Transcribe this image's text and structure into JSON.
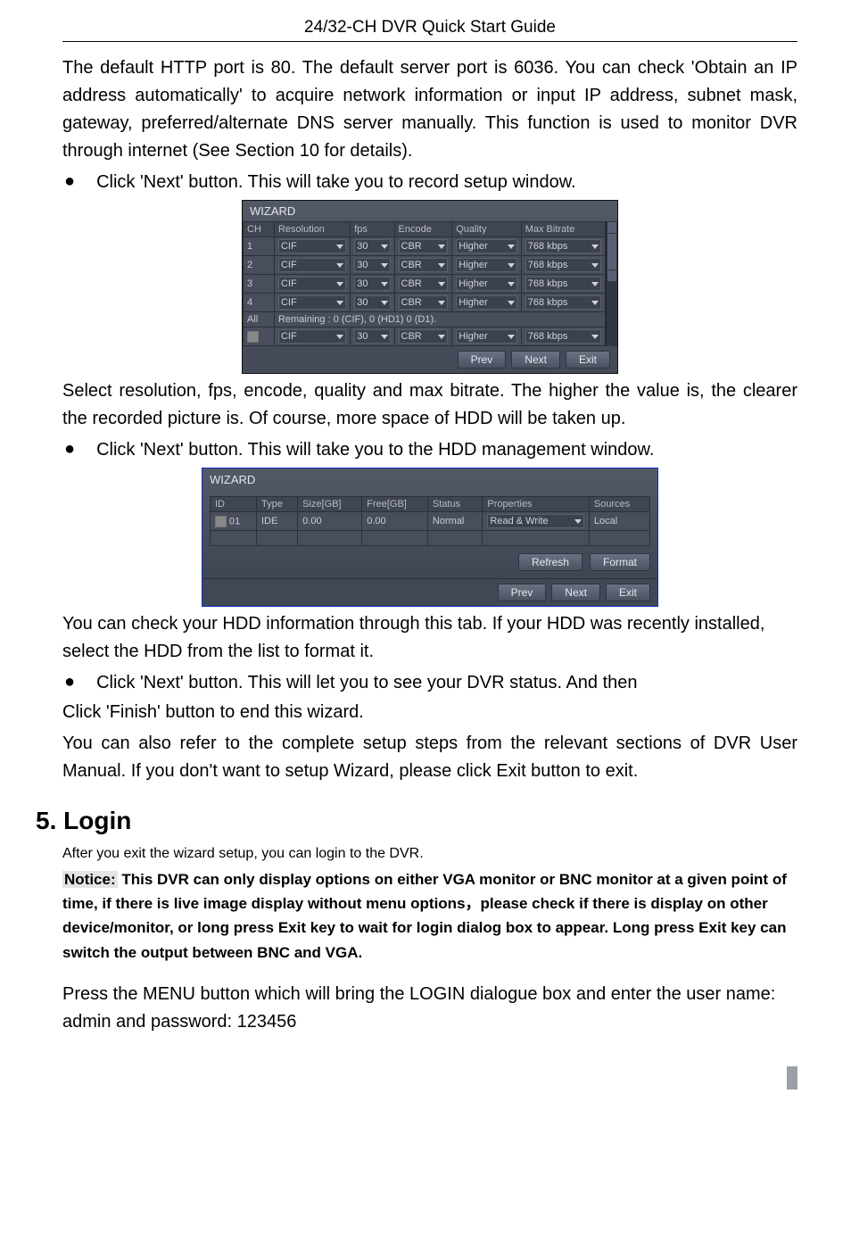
{
  "header": {
    "title": "24/32-CH DVR Quick Start Guide"
  },
  "p1": "The default HTTP port is 80. The default server port is 6036. You can check 'Obtain an IP address automatically' to acquire network information or input IP address, subnet mask, gateway, preferred/alternate DNS server manually. This function is used to monitor DVR through internet (See Section 10 for details).",
  "b1": "Click 'Next' button. This will take you to record setup window.",
  "wizardRec": {
    "title": "WIZARD",
    "cols": {
      "ch": "CH",
      "res": "Resolution",
      "fps": "fps",
      "enc": "Encode",
      "qual": "Quality",
      "br": "Max Bitrate"
    },
    "rows": [
      {
        "ch": "1",
        "res": "CIF",
        "fps": "30",
        "enc": "CBR",
        "qual": "Higher",
        "br": "768 kbps"
      },
      {
        "ch": "2",
        "res": "CIF",
        "fps": "30",
        "enc": "CBR",
        "qual": "Higher",
        "br": "768 kbps"
      },
      {
        "ch": "3",
        "res": "CIF",
        "fps": "30",
        "enc": "CBR",
        "qual": "Higher",
        "br": "768 kbps"
      },
      {
        "ch": "4",
        "res": "CIF",
        "fps": "30",
        "enc": "CBR",
        "qual": "Higher",
        "br": "768 kbps"
      }
    ],
    "allLabel": "All",
    "remaining": "Remaining  : 0 (CIF), 0 (HD1) 0 (D1).",
    "allrow": {
      "res": "CIF",
      "fps": "30",
      "enc": "CBR",
      "qual": "Higher",
      "br": "768 kbps"
    },
    "buttons": {
      "prev": "Prev",
      "next": "Next",
      "exit": "Exit"
    }
  },
  "p2": "Select resolution, fps, encode, quality and max bitrate. The higher the value is, the clearer the recorded picture is. Of course, more space of HDD will be taken up.",
  "b2": "Click 'Next' button. This will take you to the HDD management window.",
  "wizardHdd": {
    "title": "WIZARD",
    "cols": {
      "id": "ID",
      "type": "Type",
      "size": "Size[GB]",
      "free": "Free[GB]",
      "status": "Status",
      "prop": "Properties",
      "src": "Sources"
    },
    "rows": [
      {
        "id": "01",
        "type": "IDE",
        "size": "0.00",
        "free": "0.00",
        "status": "Normal",
        "prop": "Read & Write",
        "src": "Local"
      }
    ],
    "buttons": {
      "refresh": "Refresh",
      "format": "Format",
      "prev": "Prev",
      "next": "Next",
      "exit": "Exit"
    }
  },
  "p3": "You can check your HDD information through this tab. If your HDD was recently installed, select the HDD from the list to format it.",
  "b3": "Click 'Next' button. This will let you to see your DVR status. And then",
  "p3b": "Click 'Finish' button to end this wizard.",
  "p4": "You can also refer to the complete setup steps from the relevant sections of DVR User Manual. If you don't want to setup Wizard, please click Exit button to exit.",
  "h5": "5. Login",
  "p5": "After you exit the wizard setup, you can login to the DVR.",
  "noticeLabel": "Notice:",
  "notice": " This DVR can only display options on either VGA monitor or BNC monitor at a given point of time, if there is live image display without menu options，please check if there is display on other device/monitor, or long press Exit key to wait for login dialog box to appear. Long press Exit key can switch the output between BNC and VGA.",
  "p6": "Press the MENU button which will bring the LOGIN dialogue box and enter the user name: admin and password: 123456"
}
